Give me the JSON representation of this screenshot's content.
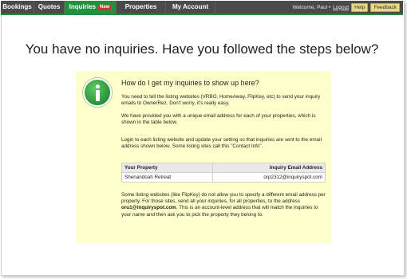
{
  "nav": {
    "tabs": [
      {
        "label": "Bookings",
        "active": false
      },
      {
        "label": "Quotes",
        "active": false
      },
      {
        "label": "Inquiries",
        "active": true,
        "badge": "New"
      },
      {
        "label": "Properties",
        "active": false
      },
      {
        "label": "My Account",
        "active": false
      }
    ],
    "welcome_text": "Welcome, Paul •",
    "logout_label": "Logout",
    "help_label": "Help",
    "feedback_label": "Feedback"
  },
  "headline": "You have no inquiries.  Have you followed the steps below?",
  "info": {
    "icon": "info-icon",
    "heading": "How do I get my inquiries to show up here?",
    "para1": "You need to tell the listing websites (VRBO, HomeAway, FlipKey, etc) to send your inquiry emails to OwnerRez.  Don't worry, it's really easy.",
    "para2": "We have provided you with a unique email address for each of your properties, which is shown in the table below.",
    "para3": "Login to each listing website and update your setting so that inquiries are sent to the email address shown below.  Some listing sites call this \"Contact Info\".",
    "table": {
      "headers": [
        "Your Property",
        "Inquiry Email Address"
      ],
      "rows": [
        [
          "Shenandoah Retreat",
          "orp2312@inquiryspot.com"
        ]
      ]
    },
    "para4_a": "Some listing websites (like FlipKey) do not allow you to specify a different email address per property.  For those sites, send all your inquiries, for all properties, to the address ",
    "para4_email": "oru1@inquiryspot.com",
    "para4_b": ".  This is an account-level address that will match the inquiries to your name and then ask you to pick the property they belong to."
  },
  "colors": {
    "nav_bg": "#4a4a4a",
    "active_tab": "#21913e",
    "badge": "#d0342c",
    "info_bg": "#ffffcc",
    "pill_bg": "#e7d88a"
  }
}
